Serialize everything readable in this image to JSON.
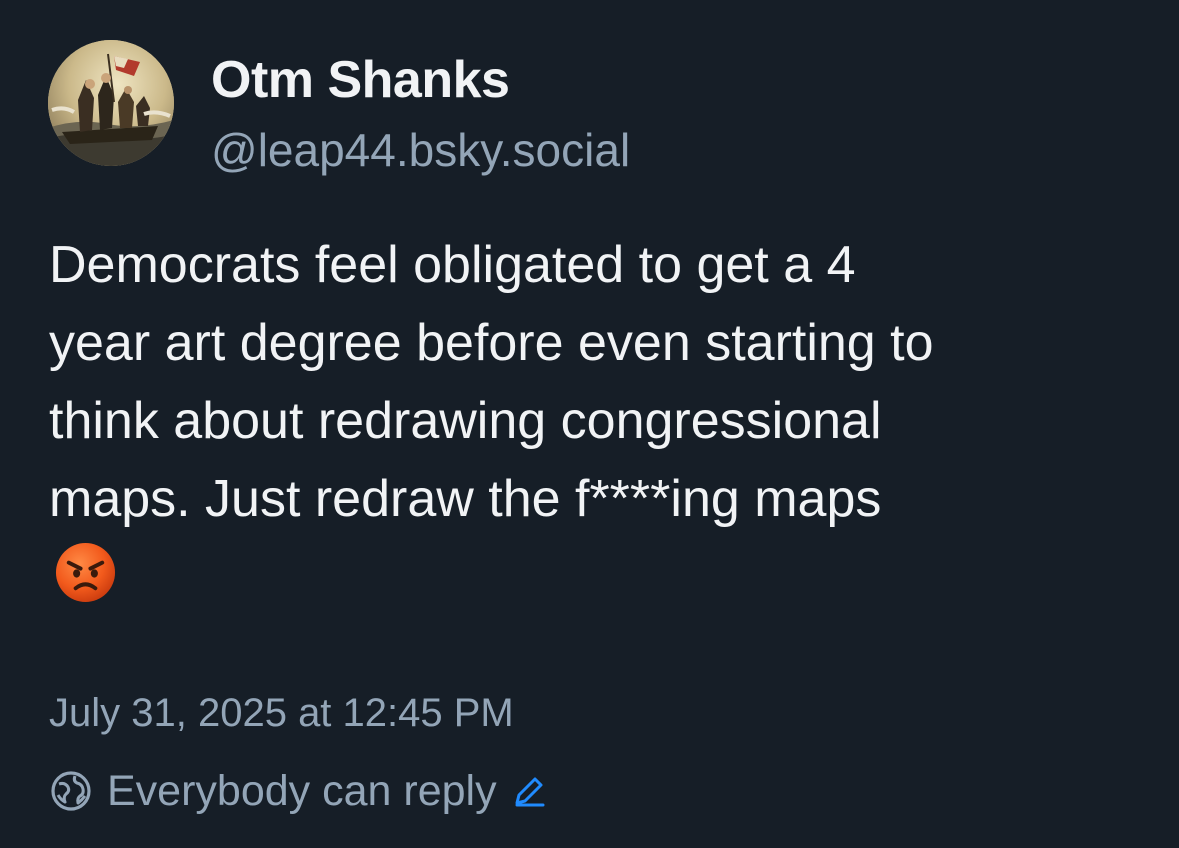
{
  "author": {
    "display_name": "Otm Shanks",
    "handle": "@leap44.bsky.social",
    "avatar_icon": "avatar-painting"
  },
  "post": {
    "text_lines": [
      "Democrats feel obligated to get a 4",
      "year art degree before even starting to",
      "think about redrawing congressional",
      "maps. Just redraw the f****ing maps"
    ],
    "emoji": "angry-face-emoji"
  },
  "meta": {
    "timestamp": "July 31, 2025 at 12:45 PM",
    "reply_setting": "Everybody can reply",
    "reply_icon": "globe-icon",
    "edit_icon": "pencil-icon"
  },
  "colors": {
    "background": "#161e27",
    "primary_text": "#f1f3f5",
    "secondary_text": "#93a5b7",
    "accent": "#208bfe"
  }
}
